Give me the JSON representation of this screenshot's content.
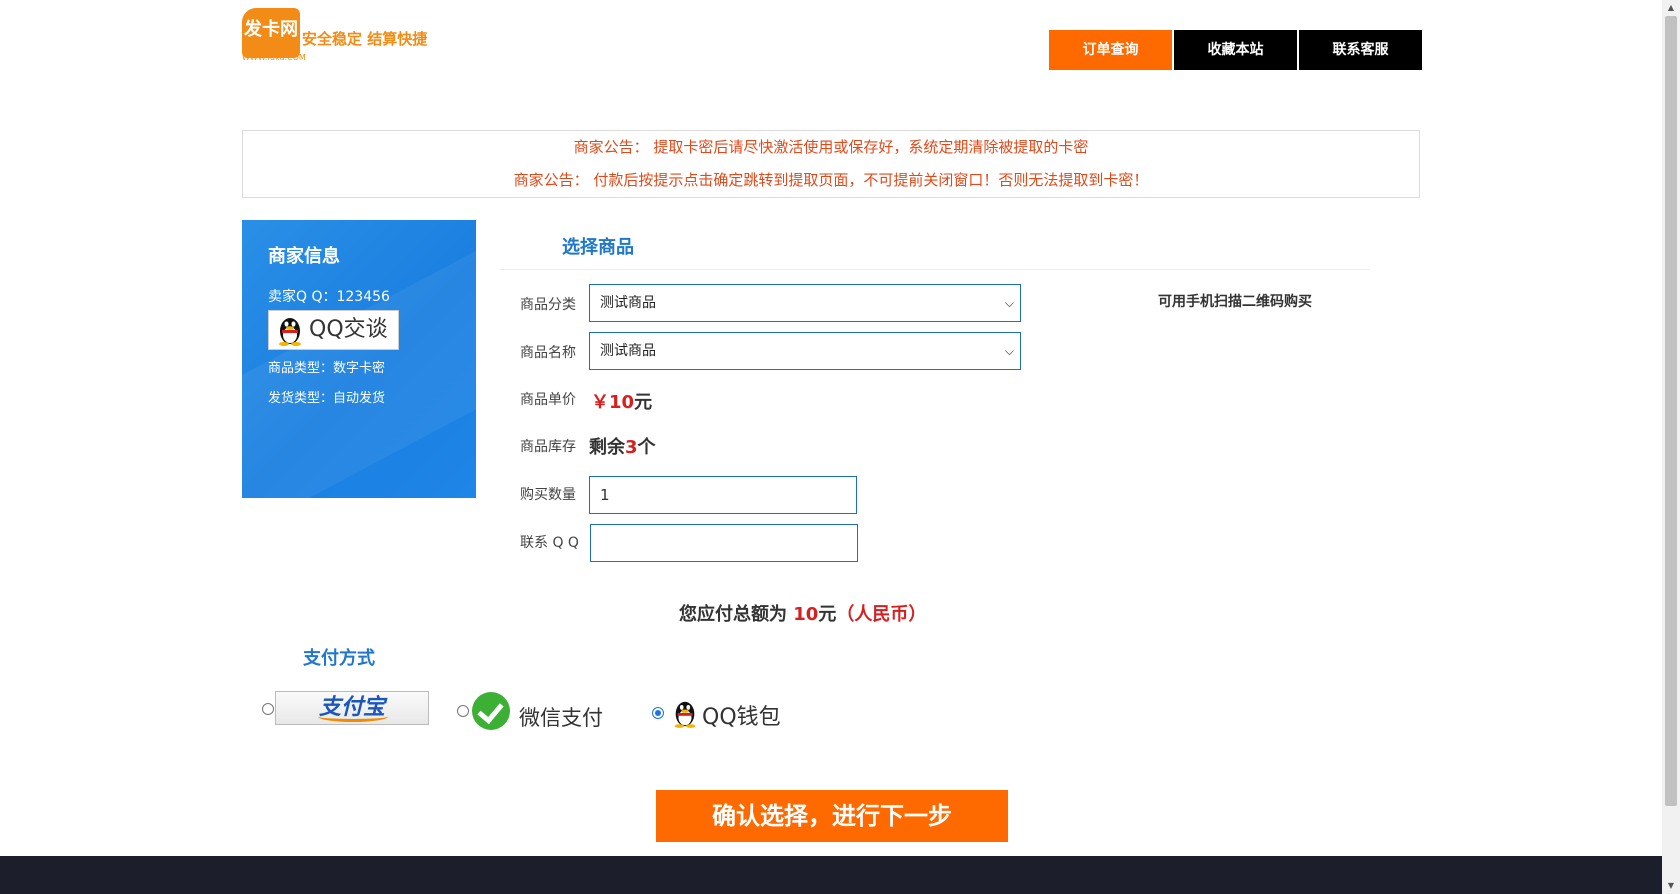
{
  "header": {
    "logo_mark": "发卡网",
    "logo_url": "WWW.faka.COM",
    "logo_slogan": "安全稳定 结算快捷",
    "nav": {
      "order_query": "订单查询",
      "bookmark": "收藏本站",
      "contact": "联系客服"
    },
    "nav_colors": {
      "order_query": "#ff6a00",
      "others": "#000000"
    }
  },
  "notice": {
    "line1": "商家公告： 提取卡密后请尽快激活使用或保存好，系统定期清除被提取的卡密",
    "line2": "商家公告： 付款后按提示点击确定跳转到提取页面，不可提前关闭窗口！否则无法提取到卡密！"
  },
  "merchant": {
    "title": "商家信息",
    "qq_line": "卖家Q Q：123456",
    "qq_chat_label": "QQ交谈",
    "product_type": "商品类型：数字卡密",
    "ship_type": "发货类型：自动发货"
  },
  "form": {
    "section_title": "选择商品",
    "category_label": "商品分类",
    "category_value": "测试商品",
    "name_label": "商品名称",
    "name_value": "测试商品",
    "price_label": "商品单价",
    "price_prefix": "￥",
    "price_value": "10",
    "price_unit": "元",
    "stock_label": "商品库存",
    "stock_prefix": "剩余",
    "stock_value": "3",
    "stock_suffix": "个",
    "quantity_label": "购买数量",
    "quantity_value": "1",
    "contact_label": "联系 Q Q",
    "contact_value": "",
    "qr_hint": "可用手机扫描二维码购买"
  },
  "total": {
    "prefix": "您应付总额为",
    "amount": "10",
    "unit": "元",
    "currency": "（人民币）"
  },
  "payment": {
    "title": "支付方式",
    "alipay_label": "支付宝",
    "wechat_label": "微信支付",
    "qqwallet_label": "QQ钱包",
    "selected": "qqwallet"
  },
  "submit_label": "确认选择，进行下一步",
  "colors": {
    "accent_orange": "#ff6a00",
    "link_blue": "#1f78c8",
    "price_red": "#d62020",
    "notice_red": "#e04a1a",
    "merchant_blue": "#1a7fe0"
  }
}
